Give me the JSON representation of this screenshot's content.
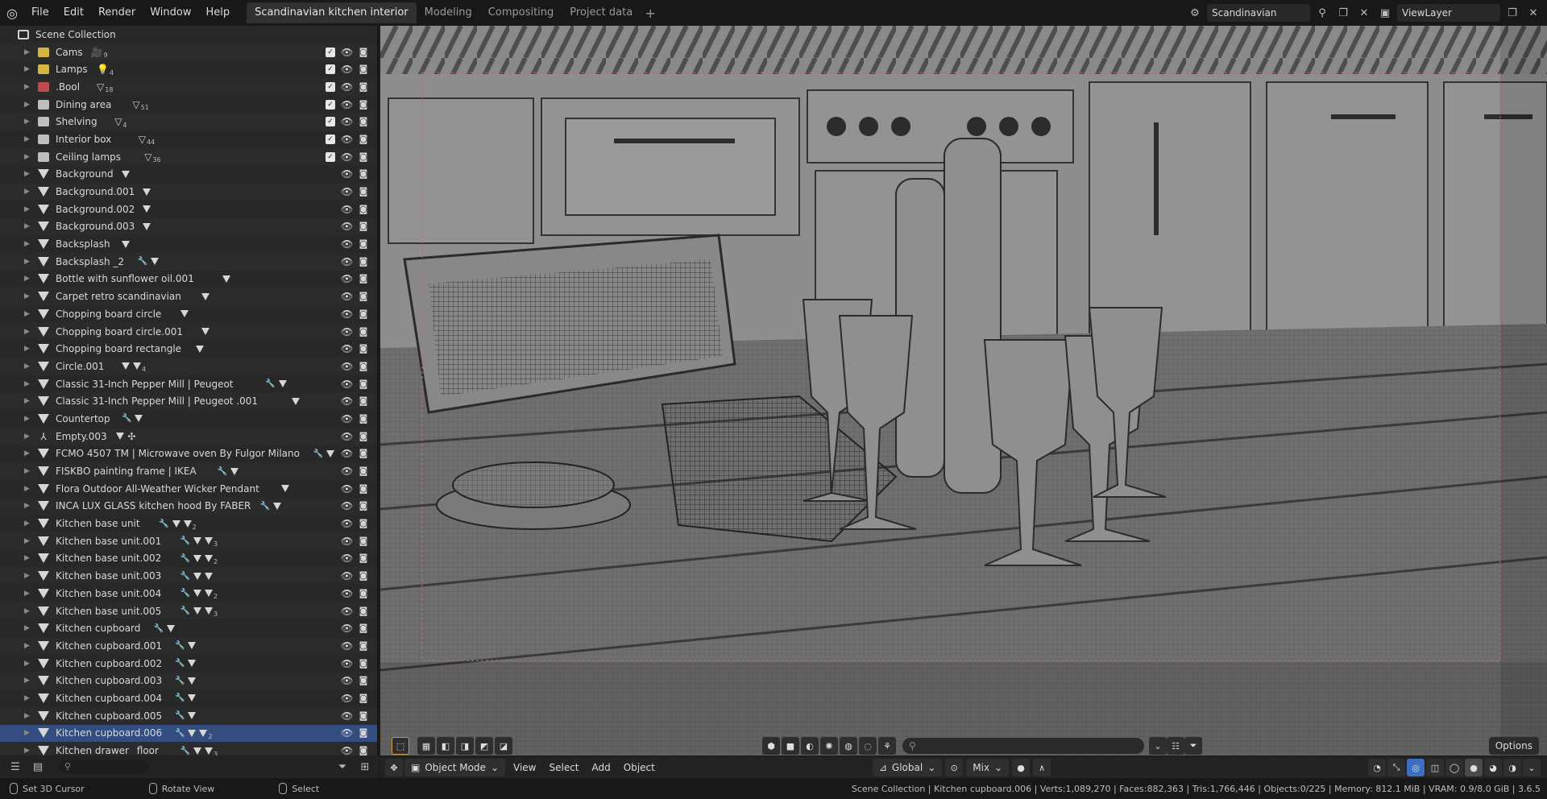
{
  "menu": [
    "File",
    "Edit",
    "Render",
    "Window",
    "Help"
  ],
  "workspaces": [
    {
      "label": "Scandinavian kitchen interior",
      "active": true
    },
    {
      "label": "Modeling",
      "active": false
    },
    {
      "label": "Compositing",
      "active": false
    },
    {
      "label": "Project data",
      "active": false
    }
  ],
  "scene_name": "Scandinavian kitchen i...",
  "view_layer": "ViewLayer",
  "outliner": {
    "root": "Scene Collection",
    "collections": [
      {
        "name": "Cams",
        "color": "#e8c445",
        "badge": "9",
        "badge_icon": "camera-icon"
      },
      {
        "name": "Lamps",
        "color": "#e8c445",
        "badge": "4",
        "badge_icon": "light-icon"
      },
      {
        "name": ".Bool",
        "color": "#d05050",
        "badge": "18",
        "badge_icon": "mesh-icon"
      },
      {
        "name": "Dining area",
        "color": "#cfcfcf",
        "badge": "51",
        "badge_icon": "mesh-icon"
      },
      {
        "name": "Shelving",
        "color": "#cfcfcf",
        "badge": "4",
        "badge_icon": "mesh-icon"
      },
      {
        "name": "Interior box",
        "color": "#cfcfcf",
        "badge": "44",
        "badge_icon": "mesh-icon"
      },
      {
        "name": "Ceiling lamps",
        "color": "#cfcfcf",
        "badge": "36",
        "badge_icon": "mesh-icon"
      }
    ],
    "objects": [
      {
        "name": "Background",
        "mods": [
          "mesh"
        ]
      },
      {
        "name": "Background.001",
        "mods": [
          "mesh"
        ]
      },
      {
        "name": "Background.002",
        "mods": [
          "mesh"
        ]
      },
      {
        "name": "Background.003",
        "mods": [
          "mesh"
        ]
      },
      {
        "name": "Backsplash",
        "mods": [
          "mesh"
        ]
      },
      {
        "name": "Backsplash _2",
        "mods": [
          "wrench",
          "mesh"
        ]
      },
      {
        "name": "Bottle with sunflower oil.001",
        "mods": [
          "mesh"
        ]
      },
      {
        "name": "Carpet retro scandinavian",
        "mods": [
          "mesh"
        ]
      },
      {
        "name": "Chopping board circle",
        "mods": [
          "mesh"
        ]
      },
      {
        "name": "Chopping board circle.001",
        "mods": [
          "mesh"
        ]
      },
      {
        "name": "Chopping board rectangle",
        "mods": [
          "mesh"
        ]
      },
      {
        "name": "Circle.001",
        "mods": [
          "mesh",
          "mesh-4"
        ]
      },
      {
        "name": "Classic 31-Inch Pepper Mill | Peugeot",
        "mods": [
          "wrench",
          "mesh"
        ]
      },
      {
        "name": "Classic 31-Inch Pepper Mill | Peugeot .001",
        "mods": [
          "mesh"
        ]
      },
      {
        "name": "Countertop",
        "mods": [
          "wrench",
          "mesh"
        ]
      },
      {
        "name": "Empty.003",
        "mods": [
          "mesh",
          "empty"
        ],
        "empty": true
      },
      {
        "name": "FCMO 4507 TM | Microwave oven By Fulgor Milano",
        "mods": [
          "wrench",
          "mesh"
        ]
      },
      {
        "name": "FISKBO painting frame | IKEA",
        "mods": [
          "wrench",
          "mesh"
        ]
      },
      {
        "name": "Flora Outdoor All-Weather Wicker Pendant",
        "mods": [
          "mesh"
        ]
      },
      {
        "name": "INCA LUX GLASS kitchen hood By FABER",
        "mods": [
          "wrench",
          "mesh"
        ]
      },
      {
        "name": "Kitchen base unit",
        "mods": [
          "wrench",
          "mesh",
          "mesh-2"
        ]
      },
      {
        "name": "Kitchen base unit.001",
        "mods": [
          "wrench",
          "mesh",
          "mesh-3"
        ]
      },
      {
        "name": "Kitchen base unit.002",
        "mods": [
          "wrench",
          "mesh",
          "mesh-2"
        ]
      },
      {
        "name": "Kitchen base unit.003",
        "mods": [
          "wrench",
          "mesh",
          "mesh"
        ]
      },
      {
        "name": "Kitchen base unit.004",
        "mods": [
          "wrench",
          "mesh",
          "mesh-2"
        ]
      },
      {
        "name": "Kitchen base unit.005",
        "mods": [
          "wrench",
          "mesh",
          "mesh-3"
        ]
      },
      {
        "name": "Kitchen cupboard",
        "mods": [
          "wrench",
          "mesh"
        ]
      },
      {
        "name": "Kitchen cupboard.001",
        "mods": [
          "wrench",
          "mesh"
        ]
      },
      {
        "name": "Kitchen cupboard.002",
        "mods": [
          "wrench",
          "mesh"
        ]
      },
      {
        "name": "Kitchen cupboard.003",
        "mods": [
          "wrench",
          "mesh"
        ]
      },
      {
        "name": "Kitchen cupboard.004",
        "mods": [
          "wrench",
          "mesh"
        ]
      },
      {
        "name": "Kitchen cupboard.005",
        "mods": [
          "wrench",
          "mesh"
        ]
      },
      {
        "name": "Kitchen cupboard.006",
        "mods": [
          "wrench",
          "mesh",
          "mesh-2"
        ],
        "active": true
      },
      {
        "name": "Kitchen drawer _floor",
        "mods": [
          "wrench",
          "mesh",
          "mesh-3"
        ]
      }
    ]
  },
  "viewport_header": {
    "mode": "Object Mode",
    "menus": [
      "View",
      "Select",
      "Add",
      "Object"
    ],
    "transform": "Global",
    "pivot": "Mix",
    "options": "Options"
  },
  "status": {
    "left1": "Set 3D Cursor",
    "left2": "Rotate View",
    "left3": "Select",
    "right": "Scene Collection | Kitchen cupboard.006 | Verts:1,089,270 | Faces:882,363 | Tris:1,766,446 | Objects:0/225 | Memory: 812.1 MiB | VRAM: 0.9/8.0 GiB | 3.6.5"
  }
}
